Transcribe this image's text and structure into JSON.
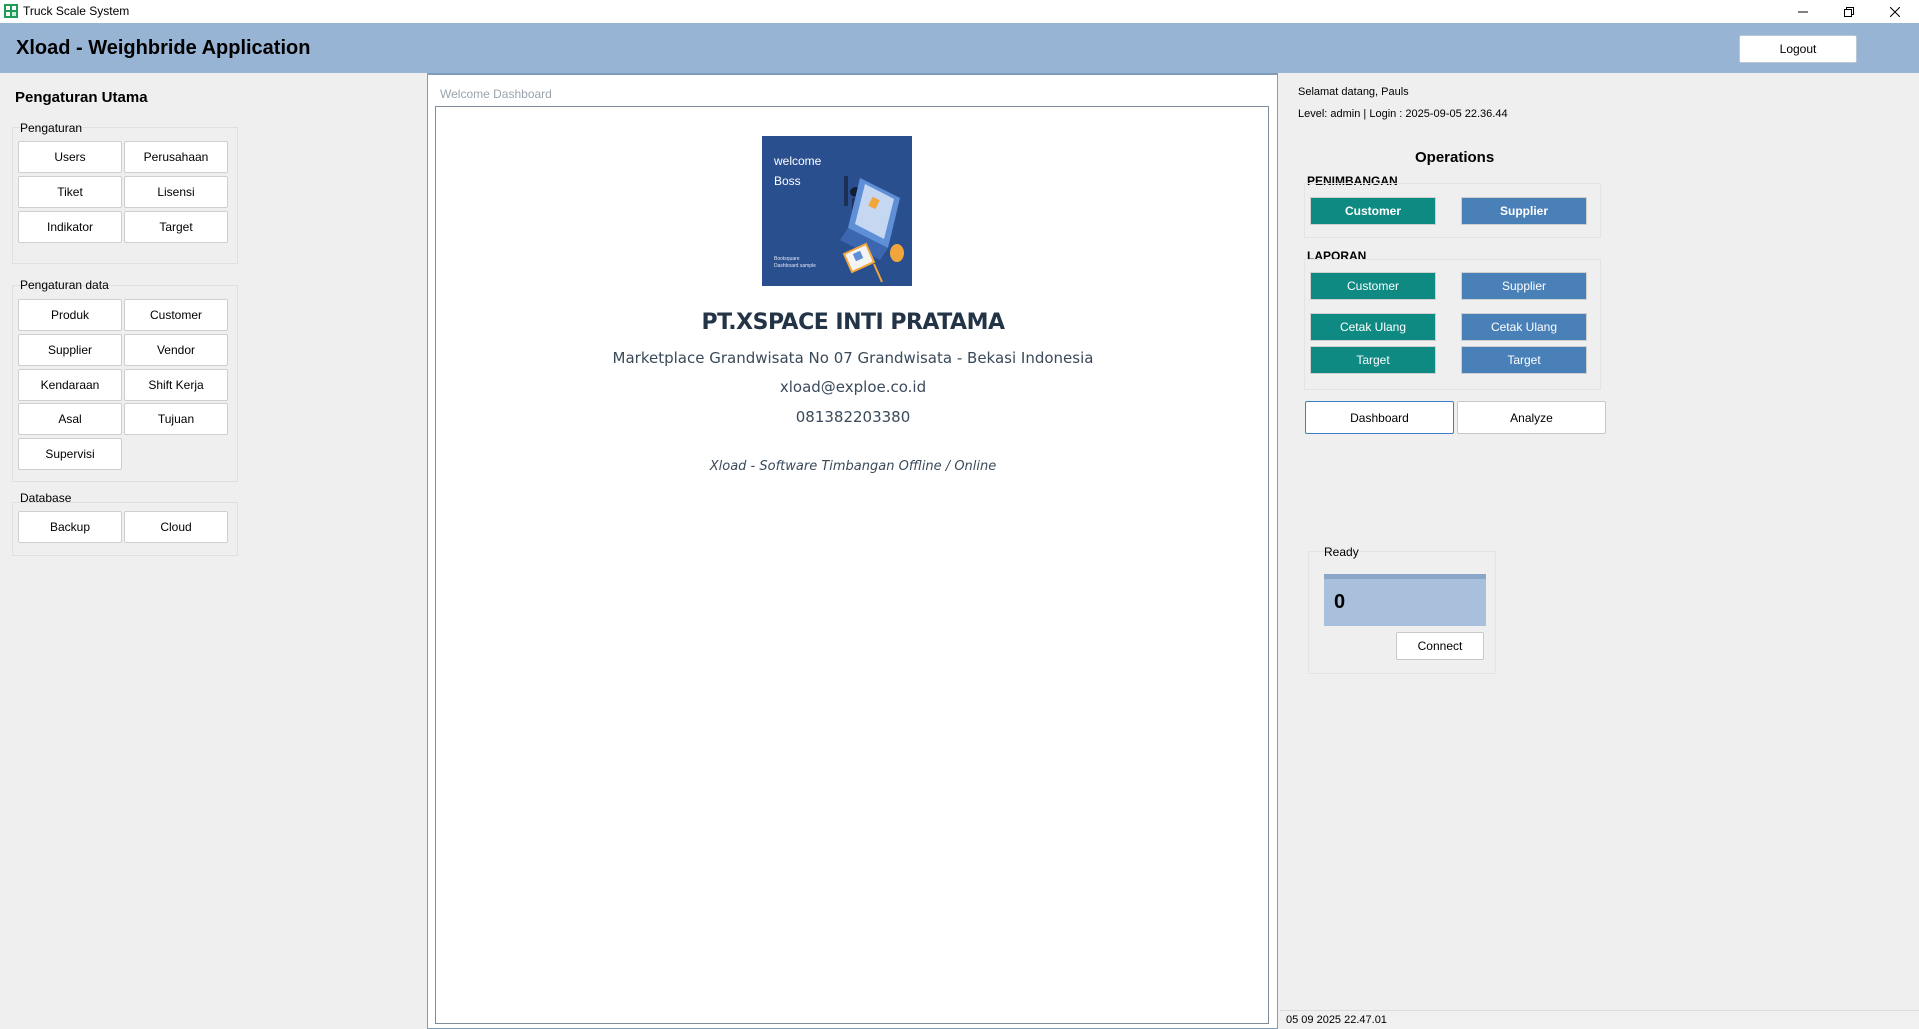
{
  "window": {
    "title": "Truck Scale System",
    "icon": "app-icon"
  },
  "header": {
    "app_title": "Xload - Weighbride Application",
    "logout_label": "Logout"
  },
  "left": {
    "title": "Pengaturan Utama",
    "groups": [
      {
        "label": "Pengaturan",
        "buttons": [
          "Users",
          "Perusahaan",
          "Tiket",
          "Lisensi",
          "Indikator",
          "Target"
        ]
      },
      {
        "label": "Pengaturan data",
        "buttons": [
          "Produk",
          "Customer",
          "Supplier",
          "Vendor",
          "Kendaraan",
          "Shift Kerja",
          "Asal",
          "Tujuan",
          "Supervisi"
        ]
      },
      {
        "label": "Database",
        "buttons": [
          "Backup",
          "Cloud"
        ]
      }
    ]
  },
  "center": {
    "caption": "Welcome Dashboard",
    "logo": {
      "line1": "welcome",
      "line2": "Boss",
      "small1": "Bootsquare",
      "small2": "Dashboard sample"
    },
    "company_name": "PT.XSPACE INTI PRATAMA",
    "address": "Marketplace Grandwisata No 07 Grandwisata - Bekasi Indonesia",
    "email": "xload@exploe.co.id",
    "phone": "081382203380",
    "tagline": "Xload - Software Timbangan Offline / Online"
  },
  "right": {
    "welcome": "Selamat datang, Pauls",
    "level": "Level: admin | Login : 2025-09-05 22.36.44",
    "operations_title": "Operations",
    "penimbangan": {
      "label": "PENIMBANGAN",
      "customer": "Customer",
      "supplier": "Supplier"
    },
    "laporan": {
      "label": "LAPORAN",
      "customer": "Customer",
      "supplier": "Supplier",
      "cetak_ulang_customer": "Cetak Ulang",
      "cetak_ulang_supplier": "Cetak Ulang",
      "target_customer": "Target",
      "target_supplier": "Target"
    },
    "nav": {
      "dashboard": "Dashboard",
      "analyze": "Analyze"
    },
    "scale": {
      "status": "Ready",
      "value": "0",
      "connect_label": "Connect"
    },
    "statusbar": "05 09 2025 22.47.01"
  },
  "colors": {
    "header": "#98b4d4",
    "teal": "#0e8a83",
    "blue": "#4a80b8"
  }
}
